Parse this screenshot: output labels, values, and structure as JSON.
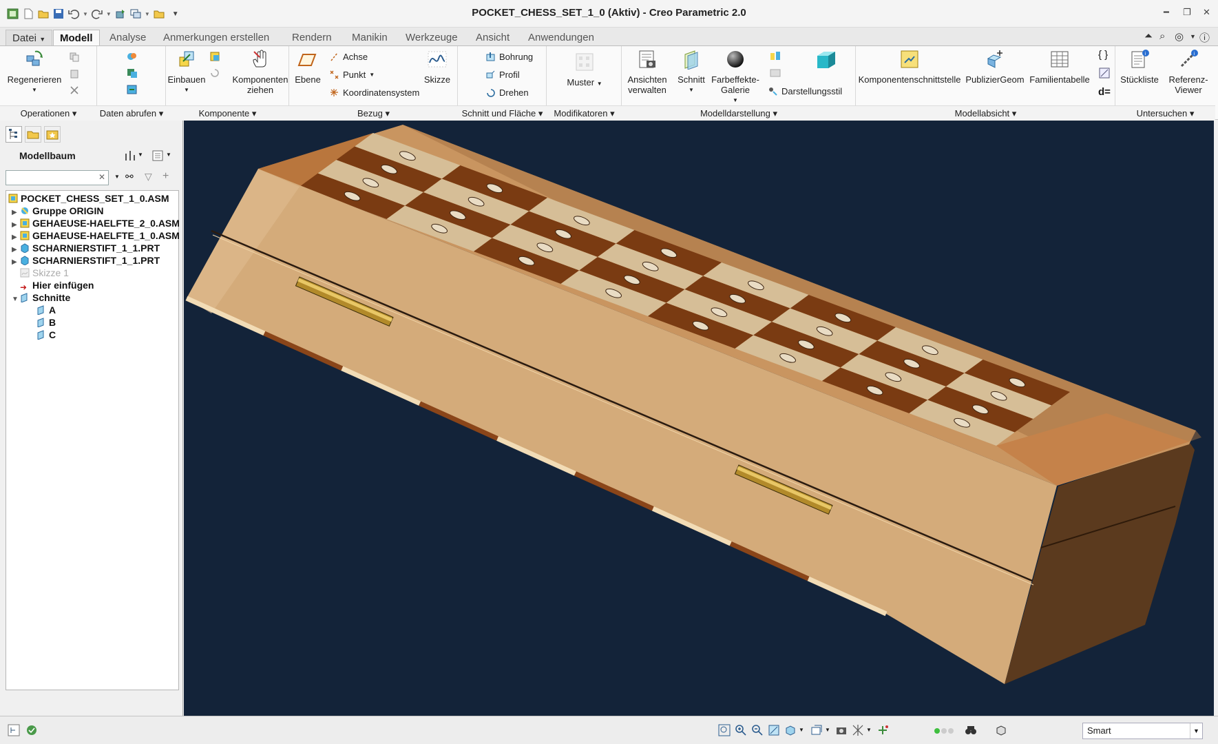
{
  "window": {
    "title": "POCKET_CHESS_SET_1_0 (Aktiv) - Creo Parametric 2.0",
    "controls": [
      "minimize",
      "maximize",
      "close"
    ]
  },
  "tabs": [
    {
      "label": "Datei",
      "dropdown": true
    },
    {
      "label": "Modell",
      "active": true
    },
    {
      "label": "Analyse"
    },
    {
      "label": "Anmerkungen erstellen"
    },
    {
      "label": "Rendern"
    },
    {
      "label": "Manikin"
    },
    {
      "label": "Werkzeuge"
    },
    {
      "label": "Ansicht"
    },
    {
      "label": "Anwendungen"
    }
  ],
  "ribbon": {
    "groups": [
      {
        "label": "Operationen"
      },
      {
        "label": "Daten abrufen"
      },
      {
        "label": "Komponente"
      },
      {
        "label": "Bezug"
      },
      {
        "label": "Schnitt und Fläche"
      },
      {
        "label": "Modifikatoren"
      },
      {
        "label": "Modelldarstellung"
      },
      {
        "label": "Modellabsicht"
      },
      {
        "label": "Untersuchen"
      }
    ],
    "buttons": {
      "regenerieren": "Regenerieren",
      "einbauen": "Einbauen",
      "komponenten_ziehen": "Komponenten ziehen",
      "ebene": "Ebene",
      "achse": "Achse",
      "punkt": "Punkt",
      "koordinatensystem": "Koordinatensystem",
      "skizze": "Skizze",
      "bohrung": "Bohrung",
      "profil": "Profil",
      "drehen": "Drehen",
      "muster": "Muster",
      "ansichten_verwalten": "Ansichten verwalten",
      "schnitt": "Schnitt",
      "farbeffekte": "Farbeffekte-Galerie",
      "darstellungsstil": "Darstellungsstil",
      "komponentenschnittstelle": "Komponentenschnittstelle",
      "publiziergeom": "PublizierGeom",
      "familientabelle": "Familientabelle",
      "d_equals": "d=",
      "stueckliste": "Stückliste",
      "referenz_viewer": "Referenz-Viewer"
    }
  },
  "model_tree": {
    "title": "Modellbaum",
    "search_value": "",
    "nodes": [
      {
        "label": "POCKET_CHESS_SET_1_0.ASM",
        "level": 0
      },
      {
        "label": "Gruppe ORIGIN",
        "level": 1
      },
      {
        "label": "GEHAEUSE-HAELFTE_2_0.ASM",
        "level": 1
      },
      {
        "label": "GEHAEUSE-HAELFTE_1_0.ASM",
        "level": 1
      },
      {
        "label": "SCHARNIERSTIFT_1_1.PRT",
        "level": 1
      },
      {
        "label": "SCHARNIERSTIFT_1_1.PRT",
        "level": 1
      },
      {
        "label": "Skizze 1",
        "level": 1,
        "dim": true
      },
      {
        "label": "Hier einfügen",
        "level": 1
      },
      {
        "label": "Schnitte",
        "level": 1,
        "expanded": true
      },
      {
        "label": "A",
        "level": 2
      },
      {
        "label": "B",
        "level": 2
      },
      {
        "label": "C",
        "level": 2
      }
    ]
  },
  "status": {
    "selection_filter": "Smart"
  },
  "colors": {
    "viewport_bg": "#132339",
    "wood_light": "#d2a979",
    "wood_dark": "#7a3b12",
    "square_light": "#d6be97",
    "hinge": "#b28a2a"
  }
}
